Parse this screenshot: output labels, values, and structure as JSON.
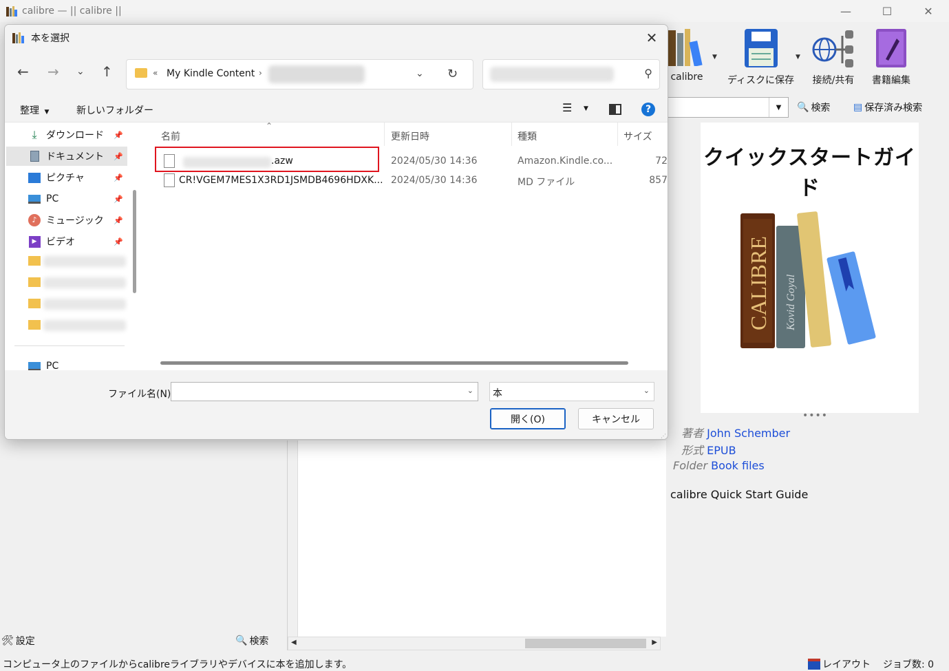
{
  "main_window": {
    "title": "calibre — || calibre ||",
    "controls": {
      "minimize": "—",
      "maximize": "☐",
      "close": "✕"
    }
  },
  "toolbar": {
    "items": [
      {
        "label": "calibre",
        "icon": "library-books-icon"
      },
      {
        "label": "ディスクに保存",
        "icon": "save-disk-icon"
      },
      {
        "label": "接続/共有",
        "icon": "connect-share-icon"
      },
      {
        "label": "書籍編集",
        "icon": "edit-book-icon"
      }
    ],
    "search_label": "検索",
    "saved_search_label": "保存済み検索"
  },
  "book_details": {
    "cover_title": "クイックスタートガイド",
    "cover_spine_text": "CALIBRE",
    "cover_author_spine": "Kovid Goyal",
    "author_key": "著者",
    "author_value": "John Schember",
    "format_key": "形式",
    "format_value": "EPUB",
    "folder_key": "Folder",
    "folder_value": "Book files",
    "description": "calibre Quick Start Guide",
    "splitter": "••••"
  },
  "bottom_bar": {
    "settings_label": "設定",
    "search_label": "検索"
  },
  "statusbar": {
    "message": "コンピュータ上のファイルからcalibreライブラリやデバイスに本を追加します。",
    "layout_label": "レイアウト",
    "jobs_label": "ジョブ数: 0"
  },
  "dialog": {
    "title": "本を選択",
    "close": "✕",
    "breadcrumb_prefix": "«",
    "breadcrumb_folder": "My Kindle Content",
    "breadcrumb_sep": "›",
    "commands": {
      "organize": "整理",
      "new_folder": "新しいフォルダー",
      "help": "?"
    },
    "nav_items": [
      {
        "label": "ダウンロード",
        "icon": "download-icon"
      },
      {
        "label": "ドキュメント",
        "icon": "documents-icon"
      },
      {
        "label": "ピクチャ",
        "icon": "pictures-icon"
      },
      {
        "label": "PC",
        "icon": "pc-icon"
      },
      {
        "label": "ミュージック",
        "icon": "music-icon"
      },
      {
        "label": "ビデオ",
        "icon": "video-icon"
      }
    ],
    "nav_bottom_label": "PC",
    "columns": {
      "name": "名前",
      "modified": "更新日時",
      "type": "種類",
      "size": "サイズ"
    },
    "files": [
      {
        "name": ".azw",
        "modified": "2024/05/30 14:36",
        "type": "Amazon.Kindle.co...",
        "size": "72"
      },
      {
        "name": "CR!VGEM7MES1X3RD1JSMDB4696HDXK...",
        "modified": "2024/05/30 14:36",
        "type": "MD ファイル",
        "size": "857"
      }
    ],
    "filename_label": "ファイル名(N):",
    "filename_value": "",
    "filetype_value": "本",
    "open_button": "開く(O)",
    "cancel_button": "キャンセル"
  }
}
